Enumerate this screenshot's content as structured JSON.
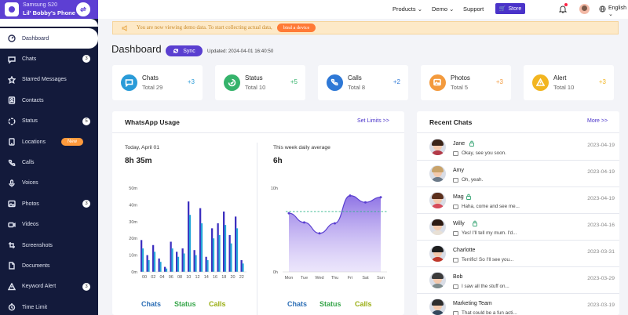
{
  "colors": {
    "brand": "#5d3fd3",
    "sidebar": "#131a3b",
    "chats": "#2a9bd8",
    "status": "#35b36b",
    "calls": "#2e78d6",
    "photos": "#f39a3d",
    "alert": "#f2b520"
  },
  "device": {
    "model": "Samsung S20",
    "name": "Lil' Bobby's Phone"
  },
  "nav": [
    {
      "label": "Dashboard",
      "icon": "dashboard-icon",
      "active": true
    },
    {
      "label": "Chats",
      "icon": "chat-icon",
      "badge": "3"
    },
    {
      "label": "Starred Messages",
      "icon": "star-icon"
    },
    {
      "label": "Contacts",
      "icon": "contacts-icon"
    },
    {
      "label": "Status",
      "icon": "status-icon",
      "badge": "5"
    },
    {
      "label": "Locations",
      "icon": "location-icon",
      "tag": "New"
    },
    {
      "label": "Calls",
      "icon": "phone-icon"
    },
    {
      "label": "Voices",
      "icon": "mic-icon"
    },
    {
      "label": "Photos",
      "icon": "photo-icon",
      "badge": "3"
    },
    {
      "label": "Videos",
      "icon": "video-icon"
    },
    {
      "label": "Screenshots",
      "icon": "screenshot-icon"
    },
    {
      "label": "Documents",
      "icon": "document-icon"
    },
    {
      "label": "Keyword Alert",
      "icon": "alert-icon",
      "badge": "3"
    },
    {
      "label": "Time Limit",
      "icon": "clock-icon"
    }
  ],
  "topbar": {
    "products": "Products",
    "demo": "Demo",
    "support": "Support",
    "store": "Store",
    "language": "English"
  },
  "banner": {
    "text": "You are now viewing demo data. To start collecting actual data,",
    "button": "bind a device"
  },
  "dashboard": {
    "title": "Dashboard",
    "sync": "Sync",
    "updated": "Updated: 2024-04-01 16:40:50"
  },
  "stats": [
    {
      "label": "Chats",
      "total": "Total  29",
      "delta": "+3",
      "icon": "chat-bubble-icon"
    },
    {
      "label": "Status",
      "total": "Total  10",
      "delta": "+5",
      "icon": "status-circle-icon"
    },
    {
      "label": "Calls",
      "total": "Total  8",
      "delta": "+2",
      "icon": "phone-icon"
    },
    {
      "label": "Photos",
      "total": "Total  5",
      "delta": "+3",
      "icon": "photo-icon"
    },
    {
      "label": "Alert",
      "total": "Total  10",
      "delta": "+3",
      "icon": "warning-icon"
    }
  ],
  "usage": {
    "title": "WhatsApp Usage",
    "set_limits": "Set Limits >>",
    "today_label": "Today, April 01",
    "today_value": "8h 35m",
    "week_label": "This week daily average",
    "week_value": "6h",
    "legend": [
      "Chats",
      "Status",
      "Calls"
    ]
  },
  "chart_data": [
    {
      "type": "bar",
      "y_ticks": [
        "0m",
        "10m",
        "20m",
        "30m",
        "40m",
        "50m"
      ],
      "x_ticks": [
        "00",
        "02",
        "04",
        "06",
        "08",
        "10",
        "12",
        "14",
        "16",
        "18",
        "20",
        "22"
      ],
      "ylim": [
        0,
        50
      ],
      "series": [
        {
          "values": [
            19,
            10,
            16,
            8,
            3,
            18,
            12,
            14,
            42,
            13,
            38,
            9,
            26,
            29,
            36,
            22,
            33,
            7
          ]
        },
        {
          "values": [
            14,
            7,
            12,
            6,
            2,
            14,
            9,
            11,
            34,
            10,
            29,
            7,
            20,
            22,
            28,
            17,
            26,
            5
          ]
        }
      ]
    },
    {
      "type": "area",
      "categories": [
        "Mon",
        "Tue",
        "Wed",
        "Thu",
        "Fri",
        "Sat",
        "Sun"
      ],
      "y_ticks": [
        "0h",
        "10h"
      ],
      "ylim": [
        0,
        10
      ],
      "values": [
        7.0,
        5.9,
        4.6,
        5.8,
        9.1,
        8.3,
        8.9
      ],
      "average": 7.2
    }
  ],
  "recent": {
    "title": "Recent Chats",
    "more": "More >>",
    "chats": [
      {
        "name": "Jane",
        "message": "Okay, see you soon.",
        "date": "2023-04-19",
        "locked": true
      },
      {
        "name": "Amy",
        "message": "Oh, yeah.",
        "date": "2023-04-19",
        "locked": false
      },
      {
        "name": "Mag",
        "message": "Haha, come and see me...",
        "date": "2023-04-19",
        "locked": true
      },
      {
        "name": "Willy",
        "message": "Yes! I'll tell my mum. I'd...",
        "date": "2023-04-16",
        "locked": true
      },
      {
        "name": "Charlotte",
        "message": "Terrific! So I'll see you...",
        "date": "2023-03-31",
        "locked": false
      },
      {
        "name": "Bob",
        "message": "I saw all the stuff on...",
        "date": "2023-03-29",
        "locked": false
      },
      {
        "name": "Marketing Team",
        "message": "That could be a fun acti...",
        "date": "2023-03-19",
        "locked": false
      }
    ]
  }
}
